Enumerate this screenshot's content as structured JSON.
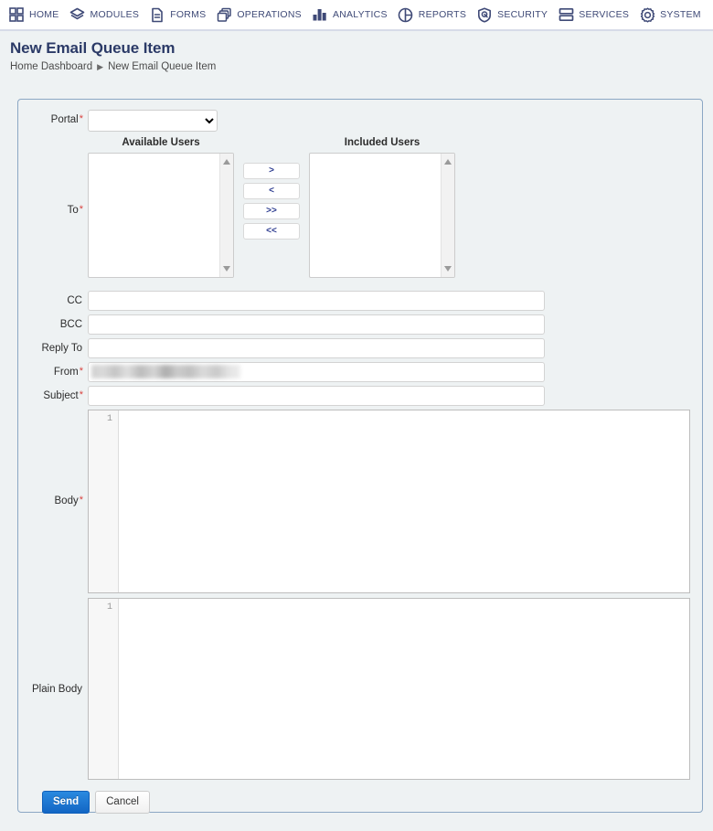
{
  "navbar": {
    "items": [
      {
        "label": "HOME",
        "icon": "grid-icon"
      },
      {
        "label": "MODULES",
        "icon": "layers-icon"
      },
      {
        "label": "FORMS",
        "icon": "document-icon"
      },
      {
        "label": "OPERATIONS",
        "icon": "copy-stack-icon"
      },
      {
        "label": "ANALYTICS",
        "icon": "bar-chart-icon"
      },
      {
        "label": "REPORTS",
        "icon": "pie-chart-icon"
      },
      {
        "label": "SECURITY",
        "icon": "shield-icon"
      },
      {
        "label": "SERVICES",
        "icon": "server-icon"
      },
      {
        "label": "SYSTEM",
        "icon": "gear-icon"
      }
    ]
  },
  "header": {
    "title": "New Email Queue Item",
    "breadcrumb": {
      "home": "Home Dashboard",
      "separator": "▶",
      "current": "New Email Queue Item"
    }
  },
  "form": {
    "portal": {
      "label": "Portal",
      "required_marker": "*",
      "value": "",
      "options": [
        ""
      ]
    },
    "to": {
      "label": "To",
      "required_marker": "*",
      "available_header": "Available Users",
      "included_header": "Included Users",
      "available_items": [],
      "included_items": [],
      "transfer_buttons": [
        {
          "name": "move-right",
          "label": ">"
        },
        {
          "name": "move-left",
          "label": "<"
        },
        {
          "name": "move-all-right",
          "label": ">>"
        },
        {
          "name": "move-all-left",
          "label": "<<"
        }
      ]
    },
    "cc": {
      "label": "CC",
      "value": "",
      "placeholder": ""
    },
    "bcc": {
      "label": "BCC",
      "value": "",
      "placeholder": ""
    },
    "reply_to": {
      "label": "Reply To",
      "value": "",
      "placeholder": ""
    },
    "from": {
      "label": "From",
      "required_marker": "*",
      "value": "",
      "redacted": true
    },
    "subject": {
      "label": "Subject",
      "required_marker": "*",
      "value": "",
      "placeholder": ""
    },
    "body": {
      "label": "Body",
      "required_marker": "*",
      "line_number": "1",
      "content": ""
    },
    "plain_body": {
      "label": "Plain Body",
      "required_marker": "",
      "line_number": "1",
      "content": ""
    }
  },
  "actions": {
    "send": "Send",
    "cancel": "Cancel"
  },
  "colors": {
    "accent": "#1266c4",
    "title": "#2b3a67",
    "nav_text": "#3f4a77",
    "required": "#d9433f",
    "panel_bg": "#eef2f3",
    "panel_border": "#8ba7c4"
  }
}
